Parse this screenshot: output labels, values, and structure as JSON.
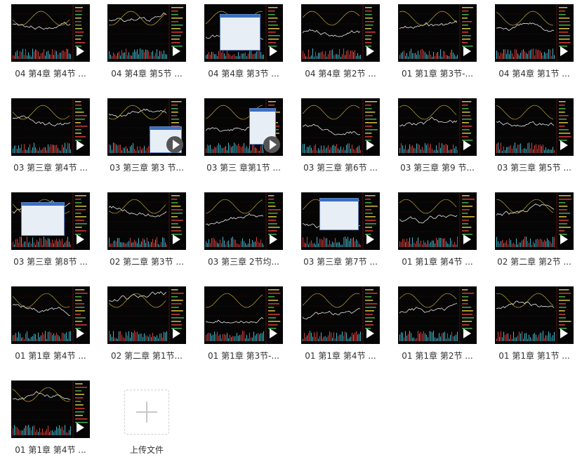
{
  "files": [
    {
      "label": "04 第4章 第4节 ..."
    },
    {
      "label": "04 第4章 第5节 ..."
    },
    {
      "label": "04 第4章 第3节 ..."
    },
    {
      "label": "04 第4章 第2节 ..."
    },
    {
      "label": "01 第1章 第3节-..."
    },
    {
      "label": "04 第4章 第1节 ..."
    },
    {
      "label": "03 第三章 第4节 ..."
    },
    {
      "label": "03 第三章 第3 节..."
    },
    {
      "label": "03 第三 章第1节 ..."
    },
    {
      "label": "03 第三章 第6节 ..."
    },
    {
      "label": "03 第三章 第9 节..."
    },
    {
      "label": "03 第三章 第5节 ..."
    },
    {
      "label": "03 第三章 第8节 ..."
    },
    {
      "label": "02 第二章 第3节 ..."
    },
    {
      "label": "03 第三章 2节均..."
    },
    {
      "label": "03 第三章 第7节 ..."
    },
    {
      "label": "01 第1章 第4节 ..."
    },
    {
      "label": "02 第二章 第2节 ..."
    },
    {
      "label": "01 第1章 第4节 ..."
    },
    {
      "label": "02 第二章  第1节..."
    },
    {
      "label": "01 第1章 第3节-..."
    },
    {
      "label": "01 第1章 第4节 ..."
    },
    {
      "label": "01 第1章 第2节 ..."
    },
    {
      "label": "01 第1章 第1节 ..."
    },
    {
      "label": "01 第1章 第4节 ..."
    }
  ],
  "upload": {
    "label": "上传文件"
  }
}
